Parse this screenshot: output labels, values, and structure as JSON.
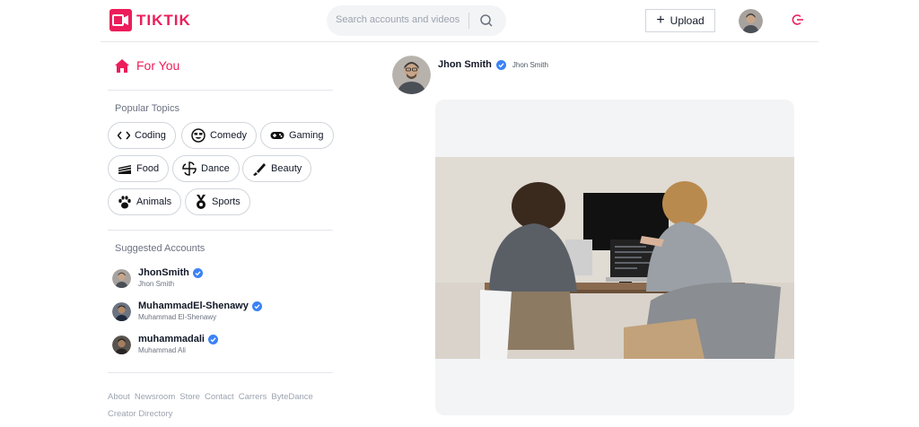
{
  "app": {
    "logo_text": "TIKTIK"
  },
  "navbar": {
    "search_placeholder": "Search accounts and videos",
    "upload_label": "Upload"
  },
  "sidebar": {
    "for_you_label": "For You",
    "popular_topics_title": "Popular Topics",
    "topics": [
      {
        "label": "Coding",
        "icon": "code-icon"
      },
      {
        "label": "Comedy",
        "icon": "smile-icon"
      },
      {
        "label": "Gaming",
        "icon": "gamepad-icon"
      },
      {
        "label": "Food",
        "icon": "cake-icon"
      },
      {
        "label": "Dance",
        "icon": "spiral-icon"
      },
      {
        "label": "Beauty",
        "icon": "brush-icon"
      },
      {
        "label": "Animals",
        "icon": "paw-icon"
      },
      {
        "label": "Sports",
        "icon": "medal-icon"
      }
    ],
    "suggested_title": "Suggested Accounts",
    "accounts": [
      {
        "name": "JhonSmith",
        "sub": "Jhon Smith"
      },
      {
        "name": "MuhammadEl-Shenawy",
        "sub": "Muhammad El-Shenawy"
      },
      {
        "name": "muhammadali",
        "sub": "Muhammad Ali"
      }
    ],
    "footer_links": [
      "About",
      "Newsroom",
      "Store",
      "Contact",
      "Carrers",
      "ByteDance",
      "Creator Directory"
    ]
  },
  "post": {
    "author_name": "Jhon Smith",
    "author_sub": "Jhon Smith"
  },
  "colors": {
    "brand": "#ec1d5a",
    "verified": "#3b82f6"
  }
}
